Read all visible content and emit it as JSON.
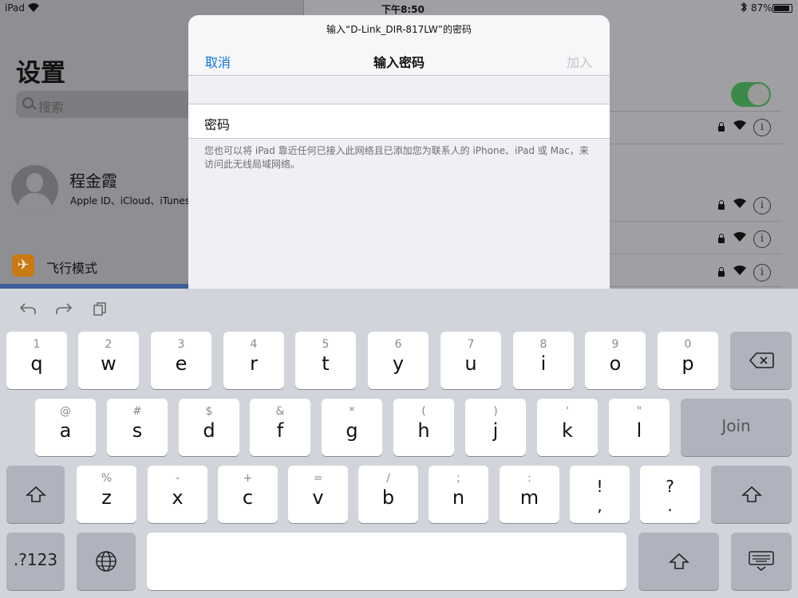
{
  "status_bar": {
    "device": "iPad",
    "time": "下午8:50",
    "battery": "87%"
  },
  "settings": {
    "title": "设置",
    "search_placeholder": "搜索",
    "profile_name": "程金霞",
    "profile_subtitle": "Apple ID、iCloud、iTunes",
    "airplane_mode": "飞行模式"
  },
  "modal": {
    "prompt": "输入“D-Link_DIR-817LW”的密码",
    "cancel": "取消",
    "title": "输入密码",
    "join": "加入",
    "password_label": "密码",
    "note": "您也可以将 iPad 靠近任何已接入此网络且已添加您为联系人的 iPhone、iPad 或 Mac，来访问此无线局域网络。"
  },
  "keyboard": {
    "row1": [
      {
        "sub": "1",
        "main": "q"
      },
      {
        "sub": "2",
        "main": "w"
      },
      {
        "sub": "3",
        "main": "e"
      },
      {
        "sub": "4",
        "main": "r"
      },
      {
        "sub": "5",
        "main": "t"
      },
      {
        "sub": "6",
        "main": "y"
      },
      {
        "sub": "7",
        "main": "u"
      },
      {
        "sub": "8",
        "main": "i"
      },
      {
        "sub": "9",
        "main": "o"
      },
      {
        "sub": "0",
        "main": "p"
      }
    ],
    "row2": [
      {
        "sub": "@",
        "main": "a"
      },
      {
        "sub": "#",
        "main": "s"
      },
      {
        "sub": "$",
        "main": "d"
      },
      {
        "sub": "&",
        "main": "f"
      },
      {
        "sub": "*",
        "main": "g"
      },
      {
        "sub": "(",
        "main": "h"
      },
      {
        "sub": ")",
        "main": "j"
      },
      {
        "sub": "'",
        "main": "k"
      },
      {
        "sub": "\"",
        "main": "l"
      }
    ],
    "row3": [
      {
        "sub": "%",
        "main": "z"
      },
      {
        "sub": "-",
        "main": "x"
      },
      {
        "sub": "+",
        "main": "c"
      },
      {
        "sub": "=",
        "main": "v"
      },
      {
        "sub": "/",
        "main": "b"
      },
      {
        "sub": ";",
        "main": "n"
      },
      {
        "sub": ":",
        "main": "m"
      }
    ],
    "punct1": {
      "top": "!",
      "bottom": ","
    },
    "punct2": {
      "top": "?",
      "bottom": "."
    },
    "join_key": "Join",
    "numbers_key": ".?123"
  }
}
